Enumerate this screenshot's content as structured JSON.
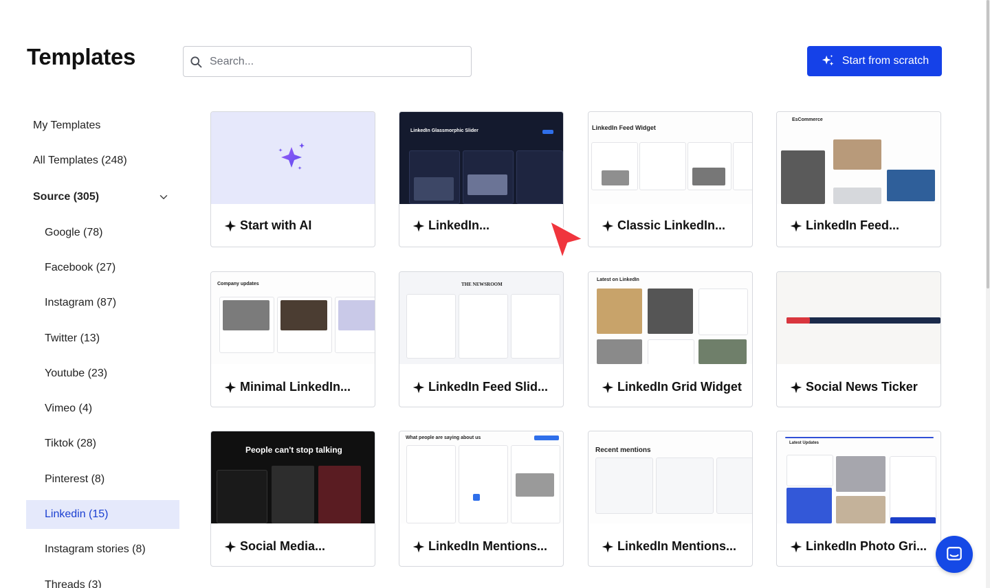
{
  "page": {
    "title": "Templates"
  },
  "search": {
    "placeholder": "Search..."
  },
  "toolbar": {
    "start_scratch_label": "Start from scratch",
    "accent_color": "#1541e8"
  },
  "sidebar": {
    "items": [
      {
        "label": "My Templates"
      },
      {
        "label": "All Templates (248)"
      },
      {
        "label": "Source (305)"
      },
      {
        "label": "Google (78)"
      },
      {
        "label": "Facebook (27)"
      },
      {
        "label": "Instagram (87)"
      },
      {
        "label": "Twitter (13)"
      },
      {
        "label": "Youtube (23)"
      },
      {
        "label": "Vimeo (4)"
      },
      {
        "label": "Tiktok (28)"
      },
      {
        "label": "Pinterest (8)"
      },
      {
        "label": "Linkedin (15)"
      },
      {
        "label": "Instagram stories (8)"
      },
      {
        "label": "Threads (3)"
      }
    ],
    "active": "Linkedin (15)"
  },
  "templates": [
    {
      "label": "Start with AI",
      "thumb": {}
    },
    {
      "label": "LinkedIn...",
      "thumb": {
        "title": "LinkedIn Glassmorphic Slider"
      }
    },
    {
      "label": "Classic LinkedIn...",
      "thumb": {
        "title": "LinkedIn Feed Widget"
      }
    },
    {
      "label": "LinkedIn Feed...",
      "thumb": {
        "title": "EsCommerce"
      }
    },
    {
      "label": "Minimal LinkedIn...",
      "thumb": {
        "title": "Company updates"
      }
    },
    {
      "label": "LinkedIn Feed Slid...",
      "thumb": {
        "title": "THE NEWSROOM"
      }
    },
    {
      "label": "LinkedIn Grid Widget",
      "thumb": {
        "title": "Latest on LinkedIn"
      }
    },
    {
      "label": "Social News Ticker",
      "thumb": {}
    },
    {
      "label": "Social Media...",
      "thumb": {
        "title": "People can't stop talking"
      }
    },
    {
      "label": "LinkedIn Mentions...",
      "thumb": {
        "title": "What people are saying about us"
      }
    },
    {
      "label": "LinkedIn Mentions...",
      "thumb": {
        "title": "Recent mentions"
      }
    },
    {
      "label": "LinkedIn Photo Gri...",
      "thumb": {
        "title": "Latest Updates"
      }
    }
  ],
  "icons": {
    "search": "search-icon",
    "sparkle": "sparkle-icon",
    "chevron": "chevron-down-icon",
    "chat": "chat-icon",
    "cursor": "cursor-arrow-icon"
  }
}
